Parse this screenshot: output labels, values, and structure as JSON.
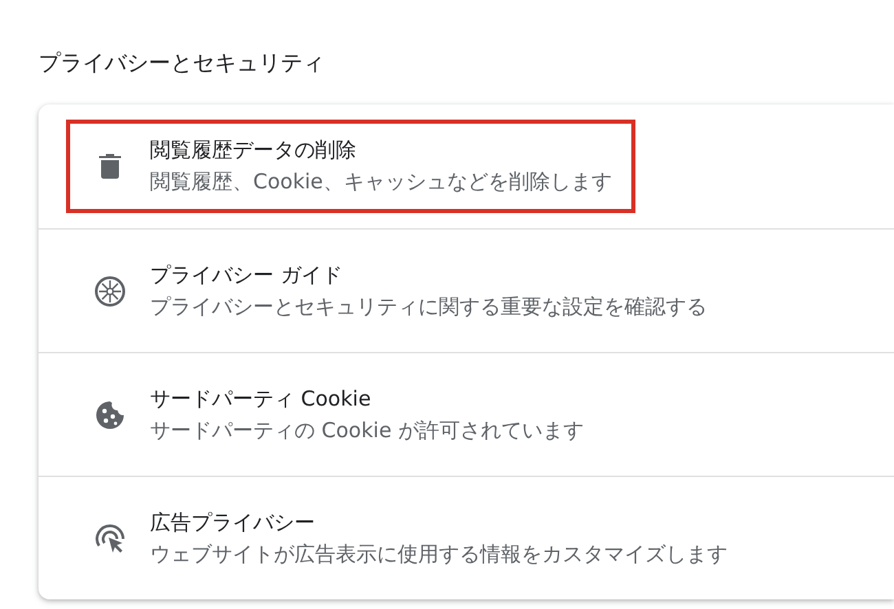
{
  "section_title": "プライバシーとセキュリティ",
  "items": [
    {
      "kind": "trash",
      "title": "閲覧履歴データの削除",
      "description": "閲覧履歴、Cookie、キャッシュなどを削除します",
      "highlighted": true
    },
    {
      "kind": "compass",
      "title": "プライバシー ガイド",
      "description": "プライバシーとセキュリティに関する重要な設定を確認する",
      "highlighted": false
    },
    {
      "kind": "cookie",
      "title": "サードパーティ Cookie",
      "description": "サードパーティの Cookie が許可されています",
      "highlighted": false
    },
    {
      "kind": "ads",
      "title": "広告プライバシー",
      "description": "ウェブサイトが広告表示に使用する情報をカスタマイズします",
      "highlighted": false
    }
  ]
}
